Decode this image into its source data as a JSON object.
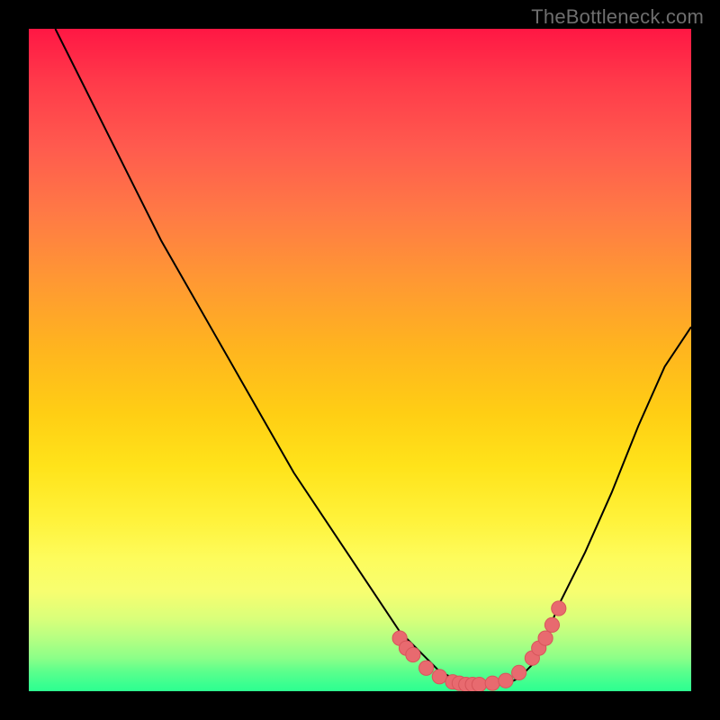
{
  "watermark": "TheBottleneck.com",
  "colors": {
    "background": "#000000",
    "curve_stroke": "#000000",
    "dot_fill": "#e86a6f",
    "dot_stroke": "#d7555b"
  },
  "chart_data": {
    "type": "line",
    "title": "",
    "xlabel": "",
    "ylabel": "",
    "xlim": [
      0,
      100
    ],
    "ylim": [
      0,
      100
    ],
    "grid": false,
    "legend": false,
    "series": [
      {
        "name": "bottleneck_curve",
        "x": [
          4,
          8,
          12,
          16,
          20,
          24,
          28,
          32,
          36,
          40,
          44,
          48,
          52,
          56,
          58,
          60,
          62,
          64,
          66,
          68,
          70,
          72,
          74,
          76,
          78,
          80,
          84,
          88,
          92,
          96,
          100
        ],
        "y": [
          100,
          92,
          84,
          76,
          68,
          61,
          54,
          47,
          40,
          33,
          27,
          21,
          15,
          9,
          7,
          5,
          3,
          2,
          1,
          1,
          1,
          1,
          2,
          4,
          8,
          13,
          21,
          30,
          40,
          49,
          55
        ]
      }
    ],
    "highlight_points": {
      "name": "scatter_dots",
      "x": [
        56,
        57,
        58,
        60,
        62,
        64,
        65,
        66,
        67,
        68,
        70,
        72,
        74,
        76,
        77,
        78,
        79,
        80
      ],
      "y": [
        8,
        6.5,
        5.5,
        3.5,
        2.2,
        1.4,
        1.2,
        1.0,
        1.0,
        1.0,
        1.2,
        1.6,
        2.8,
        5.0,
        6.5,
        8.0,
        10.0,
        12.5
      ]
    }
  }
}
